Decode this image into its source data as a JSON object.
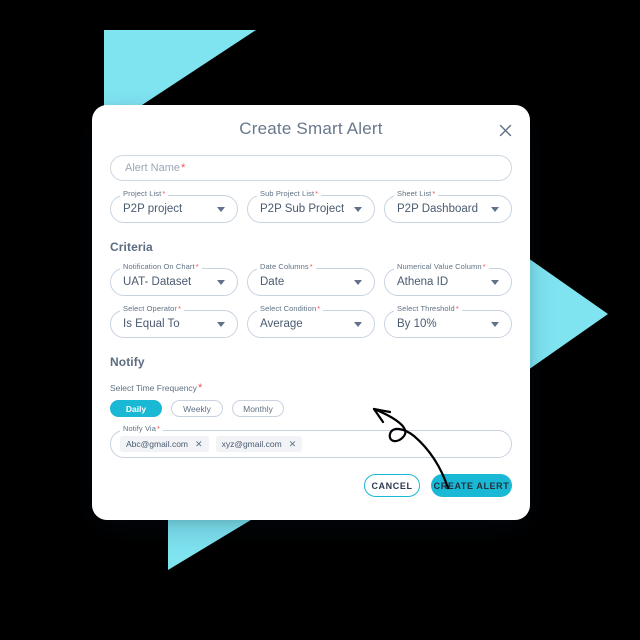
{
  "dialog": {
    "title": "Create Smart Alert",
    "close_icon": "close-icon"
  },
  "alert_name": {
    "placeholder": "Alert Name",
    "required_mark": "*"
  },
  "top_row": [
    {
      "label": "Project List",
      "required_mark": "*",
      "value": "P2P project",
      "caret_icon": "chevron-down-icon"
    },
    {
      "label": "Sub Project List",
      "required_mark": "*",
      "value": "P2P Sub Project",
      "caret_icon": "chevron-down-icon"
    },
    {
      "label": "Sheet List",
      "required_mark": "*",
      "value": "P2P Dashboard",
      "caret_icon": "chevron-down-icon"
    }
  ],
  "criteria": {
    "heading": "Criteria",
    "fields_row1": [
      {
        "label": "Notification On Chart",
        "required_mark": "*",
        "value": "UAT- Dataset",
        "caret_icon": "chevron-down-icon"
      },
      {
        "label": "Date Columns",
        "required_mark": "*",
        "value": "Date",
        "caret_icon": "chevron-down-icon"
      },
      {
        "label": "Numerical Value Column",
        "required_mark": "*",
        "value": "Athena ID",
        "caret_icon": "chevron-down-icon"
      }
    ],
    "fields_row2": [
      {
        "label": "Select Operator",
        "required_mark": "*",
        "value": "Is Equal To",
        "caret_icon": "chevron-down-icon"
      },
      {
        "label": "Select Condition",
        "required_mark": "*",
        "value": "Average",
        "caret_icon": "chevron-down-icon"
      },
      {
        "label": "Select Threshold",
        "required_mark": "*",
        "value": "By 10%",
        "caret_icon": "chevron-down-icon"
      }
    ]
  },
  "notify": {
    "heading": "Notify",
    "frequency_label": "Select Time Frequency",
    "frequency_required_mark": "*",
    "frequency_options": [
      {
        "label": "Daily",
        "selected": true
      },
      {
        "label": "Weekly",
        "selected": false
      },
      {
        "label": "Monthly",
        "selected": false
      }
    ],
    "notify_via_label": "Notify Via",
    "notify_via_required_mark": "*",
    "recipients": [
      {
        "email": "Abc@gmail.com",
        "remove_icon": "close-icon"
      },
      {
        "email": "xyz@gmail.com",
        "remove_icon": "close-icon"
      }
    ]
  },
  "actions": {
    "cancel_label": "CANCEL",
    "create_label": "CREATE ALERT"
  },
  "colors": {
    "accent": "#19b8d4",
    "accent_light": "#7fe3f0",
    "background": "#000000",
    "card": "#ffffff",
    "text_muted": "#5f7184",
    "required": "#ff4d4f"
  }
}
